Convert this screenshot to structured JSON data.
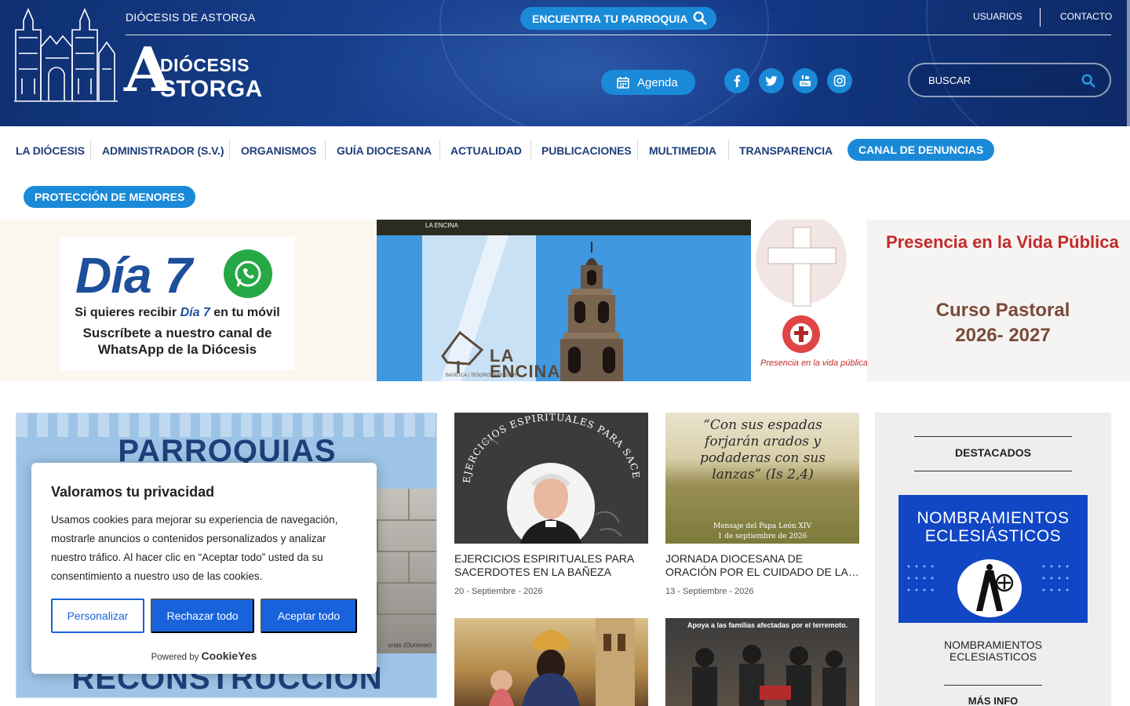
{
  "header": {
    "site_name": "DIÓCESIS DE ASTORGA",
    "brand_line1": "DIÓCESIS",
    "brand_line2": "STORGA",
    "brand_initial": "A",
    "find_parish_label": "ENCUENTRA TU PARROQUIA",
    "usuarios_label": "USUARIOS",
    "contacto_label": "CONTACTO",
    "agenda_label": "Agenda",
    "social": [
      "facebook-icon",
      "twitter-icon",
      "youtube-icon",
      "instagram-icon"
    ],
    "search_placeholder": "BUSCAR",
    "colors": {
      "header_bg": "#14398a",
      "accent": "#1a8ad8",
      "nav_text": "#1d3f7a"
    }
  },
  "nav": {
    "items": [
      "LA DIÓCESIS",
      "ADMINISTRADOR (S.V.)",
      "ORGANISMOS",
      "GUÍA DIOCESANA",
      "ACTUALIDAD",
      "PUBLICACIONES",
      "MULTIMEDIA",
      "TRANSPARENCIA"
    ],
    "canal_label": "CANAL DE DENUNCIAS",
    "proteccion_label": "PROTECCIÓN DE MENORES"
  },
  "banners": {
    "dia7": {
      "title": "Día 7",
      "line1_prefix": "Si quieres recibir",
      "line1_em": "Día 7",
      "line1_suffix": "en tu móvil",
      "line2": "Suscríbete a nuestro canal de",
      "line3": "WhatsApp de la Diócesis"
    },
    "encina": {
      "top_label": "LA ENCINA",
      "name": "LA\nENCINA",
      "sub": "BASÍLICA | TESORO | MIRADOR"
    },
    "presencia": {
      "title": "Presencia en la Vida Pública",
      "curso_line1": "Curso Pastoral",
      "curso_line2": "2026- 2027",
      "logo_text": "Presencia en la vida pública"
    }
  },
  "featured": {
    "line1": "PARROQUIAS SOLIDARIAS",
    "line2": "RECONSTRUCCIÓN",
    "photo_caption": "urias (Ourense)"
  },
  "news": [
    {
      "thumb_text": "EJERCICIOS ESPIRITUALES PARA SACERDOTES · Dirigidos por Mons. Julián Barrio Barrio",
      "title_line1": "EJERCICIOS ESPIRITUALES PARA",
      "title_line2": "SACERDOTES EN LA BAÑEZA",
      "date": "20 - Septiembre - 2026"
    },
    {
      "thumb_quote": "“Con sus espadas forjarán arados y podaderas con sus lanzas” (Is 2,4)",
      "thumb_footer1": "Mensaje del Papa León XIV",
      "thumb_footer2": "1 de septiembre de 2026",
      "title_line1": "JORNADA DIOCESANA DE",
      "title_line2": "ORACIÓN POR EL CUIDADO DE LA…",
      "date": "13 - Septiembre - 2026"
    },
    {
      "title_line1": "",
      "title_line2": "",
      "date": ""
    },
    {
      "thumb_text": "Apoya a las familias afectadas por el terremoto.",
      "title_line1": "",
      "title_line2": "",
      "date": ""
    }
  ],
  "sidebar": {
    "heading": "DESTACADOS",
    "image_title": "NOMBRAMIENTOS ECLESIÁSTICOS",
    "caption_line1": "NOMBRAMIENTOS",
    "caption_line2": "ECLESIASTICOS",
    "more_label": "MÁS INFO"
  },
  "cookie": {
    "title": "Valoramos tu privacidad",
    "text": "Usamos cookies para mejorar su experiencia de navegación, mostrarle anuncios o contenidos personalizados y analizar nuestro tráfico. Al hacer clic en “Aceptar todo” usted da su consentimiento a nuestro uso de las cookies.",
    "customize_label": "Personalizar",
    "reject_label": "Rechazar todo",
    "accept_label": "Aceptar todo",
    "powered_by": "Powered by",
    "powered_brand": "CookieYes"
  }
}
